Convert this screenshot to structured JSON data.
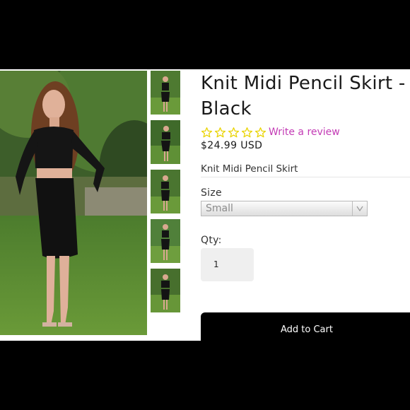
{
  "product": {
    "title": "Knit Midi Pencil Skirt - Black",
    "review_link": "Write a review",
    "price": "$24.99 USD",
    "subtitle": "Knit Midi Pencil Skirt",
    "rating": 0,
    "rating_max": 5
  },
  "options": {
    "size_label": "Size",
    "size_value": "Small",
    "qty_label": "Qty:",
    "qty_value": "1"
  },
  "actions": {
    "add_to_cart": "Add to Cart"
  },
  "gallery": {
    "thumbnail_count": 5
  },
  "colors": {
    "star": "#e9d300",
    "review_link": "#c33bb5",
    "button": "#000000"
  }
}
